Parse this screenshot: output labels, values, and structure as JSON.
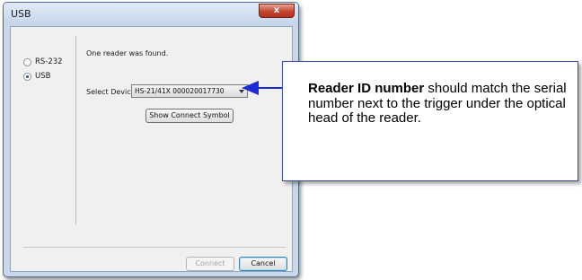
{
  "window": {
    "title": "USB",
    "close_glyph": "x"
  },
  "connection": {
    "options": [
      {
        "label": "RS-232",
        "selected": false
      },
      {
        "label": "USB",
        "selected": true
      }
    ]
  },
  "main": {
    "status": "One reader was found.",
    "select_label": "Select Device:",
    "selected_device": "HS-21/41X 000020017730",
    "show_symbol_button": "Show Connect Symbol"
  },
  "footer": {
    "connect_button": "Connect",
    "connect_disabled": true,
    "cancel_button": "Cancel"
  },
  "callout": {
    "bold_text": "Reader ID number",
    "body_text": " should match the serial number next to the trigger under the optical head of the reader."
  },
  "colors": {
    "callout_border": "#3b4ea7",
    "arrow": "#1b2bd6"
  }
}
